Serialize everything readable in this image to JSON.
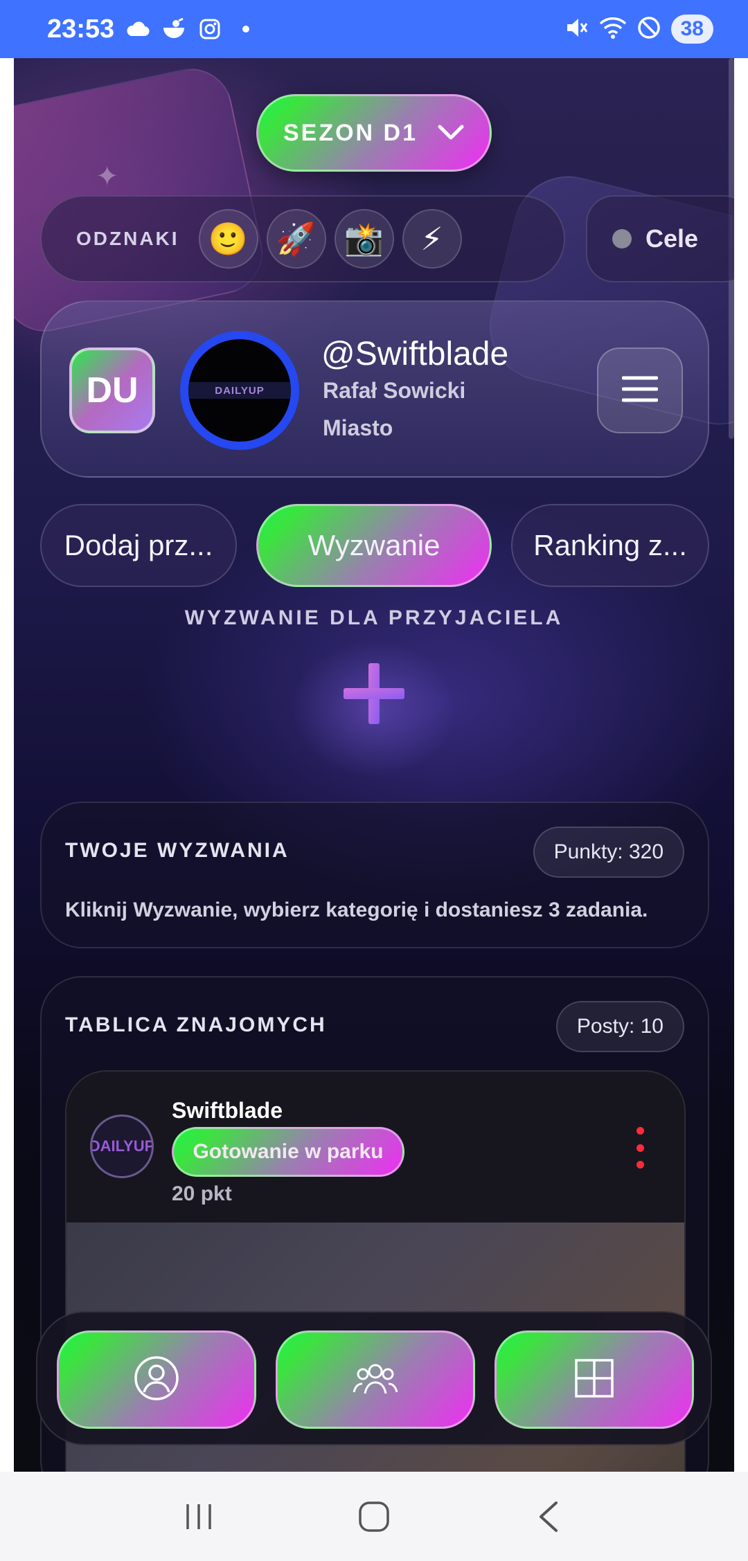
{
  "status_bar": {
    "time": "23:53",
    "left_icons": [
      "cloud-icon",
      "bowl-icon",
      "instagram-icon",
      "dot-icon"
    ],
    "right_icons": [
      "mute-icon",
      "wifi-icon",
      "dnd-icon"
    ],
    "battery": "38"
  },
  "header": {
    "season_label": "SEZON D1"
  },
  "badges": {
    "label": "ODZNAKI",
    "items": [
      "🙂",
      "🚀",
      "📸",
      "⚡"
    ]
  },
  "goals": {
    "label": "Cele"
  },
  "profile": {
    "logo_text": "DU",
    "avatar_text": "DAILYUP",
    "handle": "@Swiftblade",
    "full_name": "Rafał Sowicki",
    "city": "Miasto"
  },
  "tabs": [
    {
      "label": "Dodaj prz..."
    },
    {
      "label": "Wyzwanie"
    },
    {
      "label": "Ranking z..."
    }
  ],
  "challenge": {
    "label": "WYZWANIE DLA PRZYJACIELA"
  },
  "my_challenges": {
    "title": "TWOJE WYZWANIA",
    "points": "Punkty: 320",
    "description": "Kliknij Wyzwanie, wybierz kategorię i dostaniesz 3 zadania."
  },
  "friends_board": {
    "title": "TABLICA ZNAJOMYCH",
    "posts_count": "Posty: 10",
    "post": {
      "avatar_text": "DAILYUP",
      "author": "Swiftblade",
      "tag": "Gotowanie w parku",
      "points": "20 pkt"
    }
  },
  "bottom_nav": [
    "profile-icon",
    "friends-icon",
    "grid-icon"
  ],
  "colors": {
    "status_bar": "#3e72ff",
    "gradient_start": "#1ff24a",
    "gradient_end": "#ee2ef2",
    "avatar_ring": "#2548f0",
    "kebab": "#ff2b3a"
  }
}
